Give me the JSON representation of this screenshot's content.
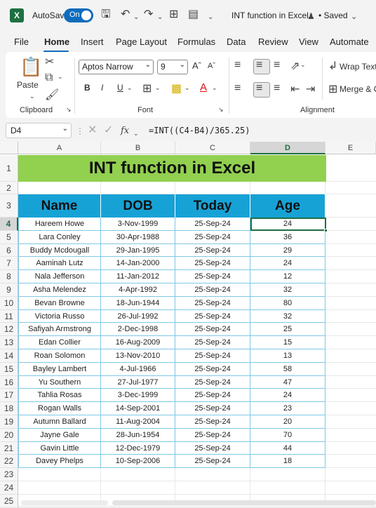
{
  "titlebar": {
    "logo": "X",
    "autosave_label": "AutoSave",
    "toggle_label": "On",
    "doc_title": "INT function in Excel",
    "saved_label": "• Saved"
  },
  "menu": {
    "items": [
      "File",
      "Home",
      "Insert",
      "Page Layout",
      "Formulas",
      "Data",
      "Review",
      "View",
      "Automate"
    ],
    "active": "Home"
  },
  "ribbon": {
    "paste_label": "Paste",
    "clipboard_label": "Clipboard",
    "font_name": "Aptos Narrow",
    "font_size": "9",
    "bold": "B",
    "italic": "I",
    "underline": "U",
    "font_label": "Font",
    "wrap_text": "Wrap Text",
    "merge": "Merge & C",
    "alignment_label": "Alignment"
  },
  "formula_bar": {
    "name_box": "D4",
    "fx": "fx",
    "formula": "=INT((C4-B4)/365.25)"
  },
  "sheet": {
    "columns": [
      "A",
      "B",
      "C",
      "D",
      "E"
    ],
    "selected_column": "D",
    "title": "INT function in Excel",
    "headers": [
      "Name",
      "DOB",
      "Today",
      "Age"
    ],
    "rows": [
      [
        "Hareem Howe",
        "3-Nov-1999",
        "25-Sep-24",
        "24"
      ],
      [
        "Lara Conley",
        "30-Apr-1988",
        "25-Sep-24",
        "36"
      ],
      [
        "Buddy Mcdougall",
        "29-Jan-1995",
        "25-Sep-24",
        "29"
      ],
      [
        "Aaminah Lutz",
        "14-Jan-2000",
        "25-Sep-24",
        "24"
      ],
      [
        "Nala Jefferson",
        "11-Jan-2012",
        "25-Sep-24",
        "12"
      ],
      [
        "Asha Melendez",
        "4-Apr-1992",
        "25-Sep-24",
        "32"
      ],
      [
        "Bevan Browne",
        "18-Jun-1944",
        "25-Sep-24",
        "80"
      ],
      [
        "Victoria Russo",
        "26-Jul-1992",
        "25-Sep-24",
        "32"
      ],
      [
        "Safiyah Armstrong",
        "2-Dec-1998",
        "25-Sep-24",
        "25"
      ],
      [
        "Edan Collier",
        "16-Aug-2009",
        "25-Sep-24",
        "15"
      ],
      [
        "Roan Solomon",
        "13-Nov-2010",
        "25-Sep-24",
        "13"
      ],
      [
        "Bayley Lambert",
        "4-Jul-1966",
        "25-Sep-24",
        "58"
      ],
      [
        "Yu Southern",
        "27-Jul-1977",
        "25-Sep-24",
        "47"
      ],
      [
        "Tahlia Rosas",
        "3-Dec-1999",
        "25-Sep-24",
        "24"
      ],
      [
        "Rogan Walls",
        "14-Sep-2001",
        "25-Sep-24",
        "23"
      ],
      [
        "Autumn Ballard",
        "11-Aug-2004",
        "25-Sep-24",
        "20"
      ],
      [
        "Jayne Gale",
        "28-Jun-1954",
        "25-Sep-24",
        "70"
      ],
      [
        "Gavin Little",
        "12-Dec-1979",
        "25-Sep-24",
        "44"
      ],
      [
        "Davey Phelps",
        "10-Sep-2006",
        "25-Sep-24",
        "18"
      ]
    ],
    "row_numbers": [
      "1",
      "2",
      "3",
      "4",
      "5",
      "6",
      "7",
      "8",
      "9",
      "10",
      "11",
      "12",
      "13",
      "14",
      "15",
      "16",
      "17",
      "18",
      "19",
      "20",
      "21",
      "22",
      "23",
      "24",
      "25"
    ],
    "selected_row": "4"
  },
  "colors": {
    "title_fill": "#92d050",
    "header_fill": "#17a2d6",
    "accent": "#1d6f42"
  }
}
